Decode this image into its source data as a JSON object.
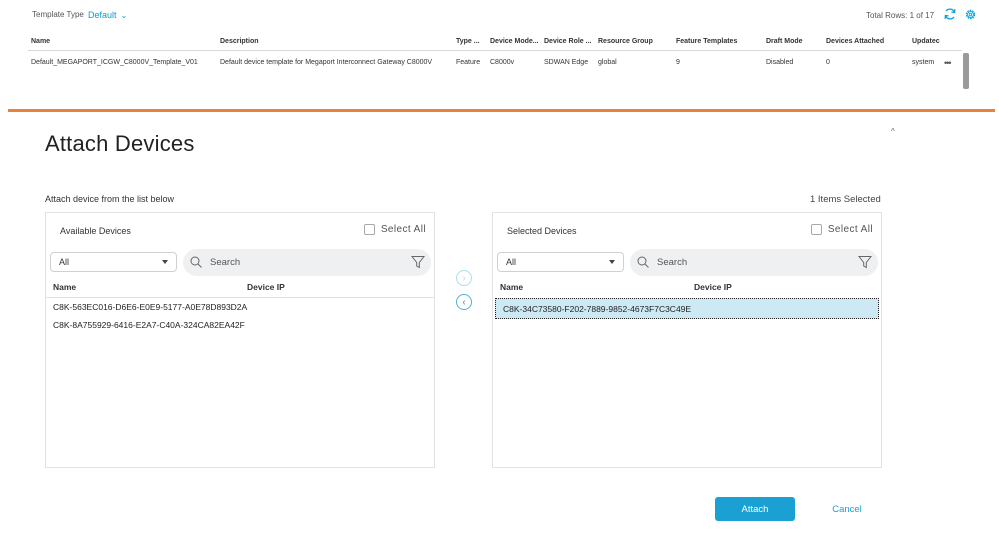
{
  "toolbar": {
    "template_type_label": "Template Type",
    "template_type_value": "Default",
    "total_rows": "Total Rows: 1 of 17"
  },
  "table": {
    "columns": [
      "Name",
      "Description",
      "Type ...",
      "Device Mode...",
      "Device Role ...",
      "Resource Group",
      "Feature Templates",
      "Draft Mode",
      "Devices Attached",
      "Updatec"
    ],
    "rows": [
      {
        "name": "Default_MEGAPORT_ICGW_C8000V_Template_V01",
        "description": "Default device template for Megaport Interconnect Gateway C8000V",
        "type": "Feature",
        "device_model": "C8000v",
        "device_role": "SDWAN Edge",
        "resource_group": "global",
        "feature_templates": "9",
        "draft_mode": "Disabled",
        "devices_attached": "0",
        "updated_by": "system"
      }
    ],
    "more_label": "•••"
  },
  "dialog": {
    "title": "Attach Devices",
    "subtitle": "Attach device from the list below",
    "items_selected": "1 Items Selected",
    "collapse_glyph": "^",
    "available": {
      "title": "Available Devices",
      "select_all": "Select All",
      "filter_value": "All",
      "search_placeholder": "Search",
      "col_name": "Name",
      "col_ip": "Device IP",
      "devices": [
        {
          "name": "C8K-563EC016-D6E6-E0E9-5177-A0E78D893D2A",
          "ip": ""
        },
        {
          "name": "C8K-8A755929-6416-E2A7-C40A-324CA82EA42F",
          "ip": ""
        }
      ]
    },
    "selected": {
      "title": "Selected Devices",
      "select_all": "Select All",
      "filter_value": "All",
      "search_placeholder": "Search",
      "col_name": "Name",
      "col_ip": "Device IP",
      "devices": [
        {
          "name": "C8K-34C73580-F202-7889-9852-4673F7C3C49E",
          "ip": ""
        }
      ]
    },
    "move_right_glyph": "›",
    "move_left_glyph": "‹",
    "attach_label": "Attach",
    "cancel_label": "Cancel"
  },
  "colors": {
    "accent": "#049fd9",
    "primary_button": "#1aa0d2",
    "divider": "#e8833a",
    "selected_row": "#cdeaf4"
  }
}
